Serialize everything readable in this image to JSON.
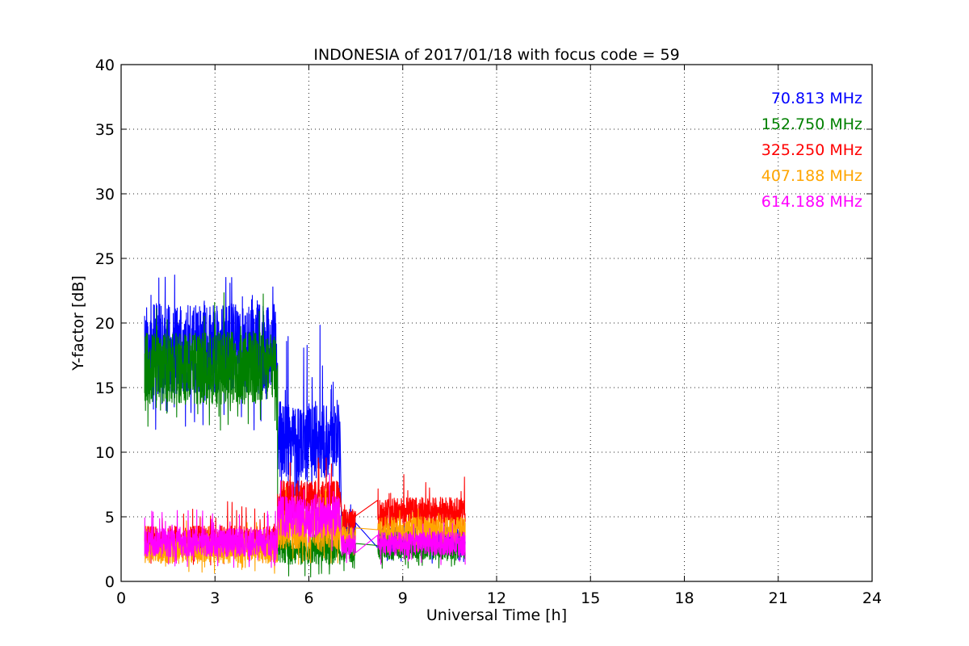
{
  "chart_data": {
    "type": "line",
    "title": "INDONESIA of 2017/01/18 with focus code = 59",
    "xlabel": "Universal Time [h]",
    "ylabel": "Y-factor [dB]",
    "xlim": [
      0,
      24
    ],
    "ylim": [
      0,
      40
    ],
    "xticks": [
      0,
      3,
      6,
      9,
      12,
      15,
      18,
      21,
      24
    ],
    "yticks": [
      0,
      5,
      10,
      15,
      20,
      25,
      30,
      35,
      40
    ],
    "xtick_labels": [
      "0",
      "3",
      "6",
      "9",
      "12",
      "15",
      "18",
      "21",
      "24"
    ],
    "ytick_labels": [
      "0",
      "5",
      "10",
      "15",
      "20",
      "25",
      "30",
      "35",
      "40"
    ],
    "grid": true,
    "legend_position": "top-right",
    "series": [
      {
        "name": "70.813 MHz",
        "color": "#0000ff",
        "segments": [
          {
            "x0": 0.75,
            "x1": 5.0,
            "base": 18.0,
            "amp": 3.5,
            "spike_max": 24.2
          },
          {
            "x0": 5.0,
            "x1": 7.0,
            "base": 11.0,
            "amp": 3.0,
            "spike_max": 19.9
          },
          {
            "x0": 7.05,
            "x1": 7.5,
            "base": 3.6,
            "amp": 1.2,
            "spike_max": 6.0
          },
          {
            "x0": 8.2,
            "x1": 11.0,
            "base": 3.2,
            "amp": 1.0,
            "spike_max": 5.5
          }
        ]
      },
      {
        "name": "152.750 MHz",
        "color": "#008000",
        "segments": [
          {
            "x0": 0.75,
            "x1": 5.0,
            "base": 16.5,
            "amp": 2.8,
            "spike_max": 22.5
          },
          {
            "x0": 5.0,
            "x1": 7.0,
            "base": 2.6,
            "amp": 1.3,
            "spike_max": 5.0
          },
          {
            "x0": 7.05,
            "x1": 7.5,
            "base": 2.4,
            "amp": 0.9,
            "spike_max": 4.0
          },
          {
            "x0": 8.2,
            "x1": 11.0,
            "base": 2.6,
            "amp": 0.9,
            "spike_max": 4.5
          }
        ]
      },
      {
        "name": "325.250 MHz",
        "color": "#ff0000",
        "segments": [
          {
            "x0": 0.75,
            "x1": 5.0,
            "base": 3.2,
            "amp": 1.1,
            "spike_max": 6.2
          },
          {
            "x0": 5.0,
            "x1": 7.0,
            "base": 6.2,
            "amp": 1.6,
            "spike_max": 9.8
          },
          {
            "x0": 7.05,
            "x1": 7.5,
            "base": 4.6,
            "amp": 1.0,
            "spike_max": 6.5
          },
          {
            "x0": 8.2,
            "x1": 11.0,
            "base": 5.3,
            "amp": 1.2,
            "spike_max": 8.4
          }
        ]
      },
      {
        "name": "407.188 MHz",
        "color": "#ffa500",
        "segments": [
          {
            "x0": 0.75,
            "x1": 5.0,
            "base": 2.4,
            "amp": 1.0,
            "spike_max": 4.8
          },
          {
            "x0": 5.0,
            "x1": 7.0,
            "base": 4.0,
            "amp": 1.5,
            "spike_max": 7.5
          },
          {
            "x0": 7.05,
            "x1": 7.5,
            "base": 3.4,
            "amp": 0.9,
            "spike_max": 5.2
          },
          {
            "x0": 8.2,
            "x1": 11.0,
            "base": 4.0,
            "amp": 1.0,
            "spike_max": 6.2
          }
        ]
      },
      {
        "name": "614.188 MHz",
        "color": "#ff00ff",
        "segments": [
          {
            "x0": 0.75,
            "x1": 5.0,
            "base": 3.0,
            "amp": 1.1,
            "spike_max": 5.6
          },
          {
            "x0": 5.0,
            "x1": 7.0,
            "base": 5.0,
            "amp": 1.6,
            "spike_max": 8.5
          },
          {
            "x0": 7.05,
            "x1": 7.5,
            "base": 2.8,
            "amp": 0.8,
            "spike_max": 4.5
          },
          {
            "x0": 8.2,
            "x1": 11.0,
            "base": 2.9,
            "amp": 0.9,
            "spike_max": 4.6
          }
        ]
      }
    ]
  }
}
